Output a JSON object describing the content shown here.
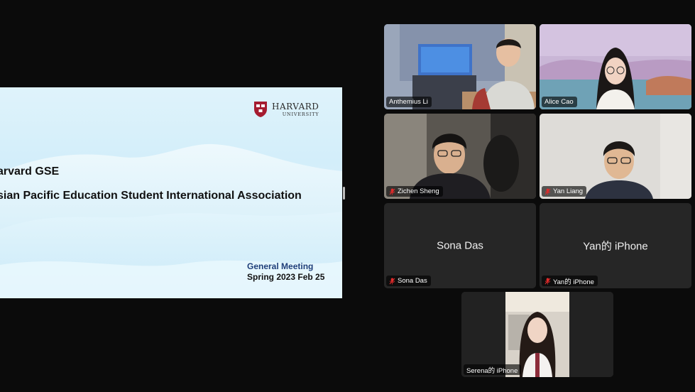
{
  "slide": {
    "title_line_1": "arvard GSE",
    "title_line_2": "sian Pacific Education Student International Association",
    "meeting": "General Meeting",
    "date": "Spring 2023 Feb 25",
    "logo_name": "HARVARD",
    "logo_sub": "UNIVERSITY"
  },
  "participants": [
    {
      "name": "Anthemius Li",
      "muted": false,
      "video": true,
      "active_speaker": false,
      "icon": "none"
    },
    {
      "name": "Alice Cao",
      "muted": false,
      "video": true,
      "active_speaker": true,
      "icon": "none"
    },
    {
      "name": "Zichen Sheng",
      "muted": true,
      "video": true,
      "active_speaker": false,
      "icon": "mic-off-icon"
    },
    {
      "name": "Yan Liang",
      "muted": true,
      "video": true,
      "active_speaker": false,
      "icon": "mic-off-icon"
    },
    {
      "name": "Sona Das",
      "display_name": "Sona Das",
      "muted": true,
      "video": false,
      "active_speaker": false,
      "icon": "mic-off-icon"
    },
    {
      "name": "Yan的 iPhone",
      "display_name": "Yan的 iPhone",
      "muted": true,
      "video": false,
      "active_speaker": false,
      "icon": "mic-off-icon"
    },
    {
      "name": "Serena的 iPhone",
      "muted": false,
      "video": true,
      "active_speaker": false,
      "icon": "none"
    }
  ],
  "colors": {
    "background": "#0b0b0b",
    "active_speaker_border": "#2ecc40",
    "mic_off": "#e02b2b",
    "meeting_text": "#1f3f7a",
    "harvard_crimson": "#a51c30"
  }
}
